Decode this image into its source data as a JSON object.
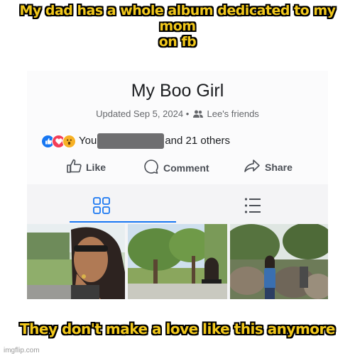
{
  "meme": {
    "top_line1": "My dad has a whole album dedicated to my mom",
    "top_line2": "on fb",
    "bottom": "They don't make a love like this anymore"
  },
  "album": {
    "title": "My Boo Girl",
    "updated": "Updated Sep 5, 2024",
    "separator": "•",
    "audience": "Lee's friends",
    "audience_icon": "friends-icon"
  },
  "reactions": {
    "icons": [
      "like-reaction-icon",
      "love-reaction-icon",
      "wow-reaction-icon"
    ],
    "prefix": "You",
    "suffix": "and 21 others"
  },
  "actions": {
    "like": "Like",
    "comment": "Comment",
    "share": "Share"
  },
  "tabs": {
    "active": "grid-view",
    "items": [
      "grid-view-icon",
      "list-view-icon"
    ]
  },
  "photos": [
    "photo-woman-sunglasses",
    "photo-woman-park-trees",
    "photo-woman-rock-garden"
  ],
  "watermark": "imgflip.com",
  "colors": {
    "meme_text": "#f2c81b",
    "facebook_blue": "#1877f2",
    "love_red": "#f33e58",
    "wow_yellow": "#f7b125"
  }
}
